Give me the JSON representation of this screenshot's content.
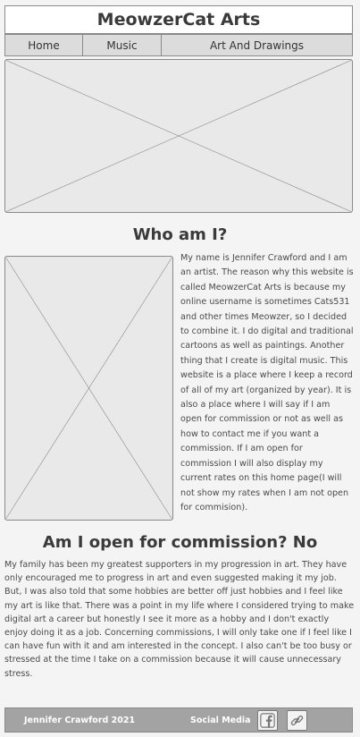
{
  "site": {
    "title": "MeowzerCat Arts"
  },
  "nav": {
    "items": [
      {
        "label": "Home"
      },
      {
        "label": "Music"
      },
      {
        "label": "Art And Drawings"
      }
    ]
  },
  "about": {
    "heading": "Who am I?",
    "body": "My name is Jennifer Crawford and I am an artist. The reason why this website is called MeowzerCat Arts is because my online username is sometimes Cats531 and other times Meowzer, so I decided to combine it. I do digital and traditional cartoons as well as paintings. Another thing that I create is digital music. This website is a place where I keep a record of all of my art  (organized by year). It is also a place where I will say if I am open for commission or not as well as how to contact me if you want a commission. If I am open for commission I will also display my current rates on this home page(I will not show my rates when I am not open for commision)."
  },
  "commission": {
    "heading": "Am I open for commission? No",
    "body": "My family has been my greatest supporters in my progression in art. They have only encouraged me to progress in art and even suggested making it my job. But, I was also told that some hobbies are better off just hobbies and I feel like my art is like that. There was a point in my life where I considered trying to make digital art a career but honestly I see it more as a hobby and I don't exactly enjoy doing it as a job. Concerning commissions, I will only take one if I feel like I can have fun with it and am interested in the concept. I also can't be too busy or stressed at the time I take on a commission because it will cause unnecessary stress."
  },
  "footer": {
    "copyright": "Jennifer Crawford 2021",
    "social_label": "Social Media",
    "icons": [
      "facebook-icon",
      "link-icon"
    ]
  }
}
